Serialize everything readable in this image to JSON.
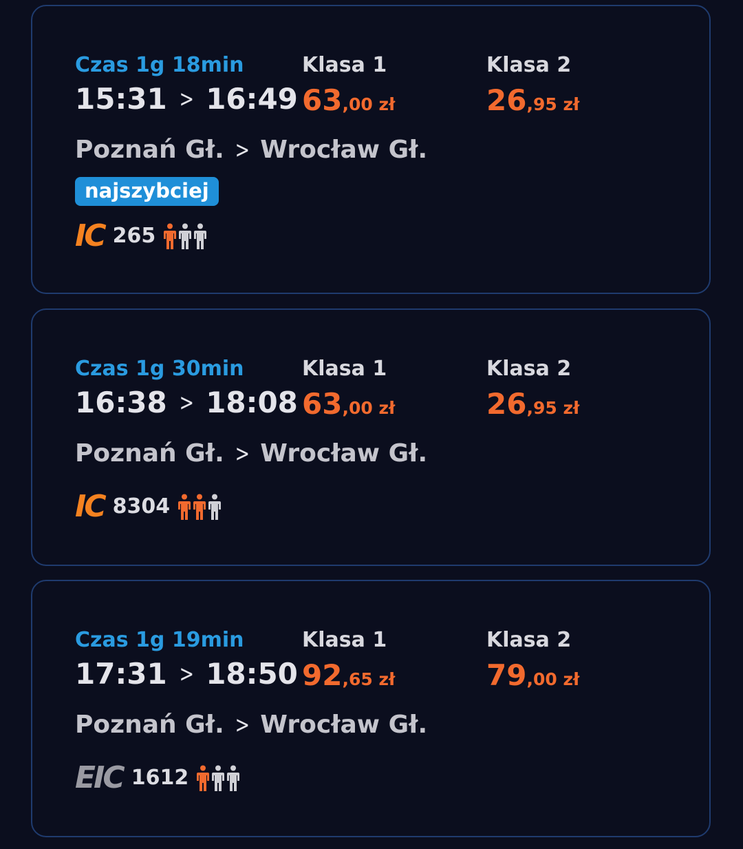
{
  "colors": {
    "background": "#0b0e1e",
    "card_border": "#1f3b6e",
    "duration": "#2a9be0",
    "price": "#f26a2e",
    "badge": "#1f8fd8",
    "occupancy_filled": "#f26a2e",
    "occupancy_empty": "#d0d0d6"
  },
  "connections": [
    {
      "duration": "Czas 1g 18min",
      "departure": "16:49",
      "departure_time": "15:31",
      "arrival_time": "16:49",
      "class1_label": "Klasa 1",
      "class1_price_main": "63",
      "class1_price_rest": ",00 zł",
      "class2_label": "Klasa 2",
      "class2_price_main": "26",
      "class2_price_rest": ",95 zł",
      "from": "Poznań Gł.",
      "to": "Wrocław Gł.",
      "badge": "najszybciej",
      "carrier_logo": "IC",
      "train_number": "265",
      "occupancy_icon": "person-icon",
      "occupancy_level": 1,
      "occupancy_max": 3
    },
    {
      "duration": "Czas 1g 30min",
      "departure_time": "16:38",
      "arrival_time": "18:08",
      "class1_label": "Klasa 1",
      "class1_price_main": "63",
      "class1_price_rest": ",00 zł",
      "class2_label": "Klasa 2",
      "class2_price_main": "26",
      "class2_price_rest": ",95 zł",
      "from": "Poznań Gł.",
      "to": "Wrocław Gł.",
      "carrier_logo": "IC",
      "train_number": "8304",
      "occupancy_icon": "person-icon",
      "occupancy_level": 2,
      "occupancy_max": 3
    },
    {
      "duration": "Czas 1g 19min",
      "departure_time": "17:31",
      "arrival_time": "18:50",
      "class1_label": "Klasa 1",
      "class1_price_main": "92",
      "class1_price_rest": ",65 zł",
      "class2_label": "Klasa 2",
      "class2_price_main": "79",
      "class2_price_rest": ",00 zł",
      "from": "Poznań Gł.",
      "to": "Wrocław Gł.",
      "carrier_logo": "EIC",
      "train_number": "1612",
      "occupancy_icon": "person-icon",
      "occupancy_level": 1,
      "occupancy_max": 3
    }
  ]
}
